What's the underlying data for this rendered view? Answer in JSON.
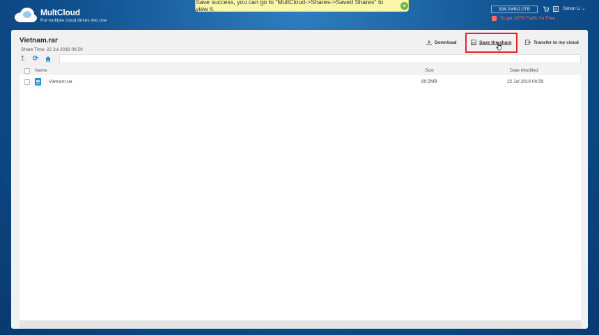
{
  "header": {
    "logo_title": "MultCloud",
    "logo_subtitle": "Put multiple cloud drives into one",
    "toast_message": "Save success, you can go to \"MultCloud->Shares->Saved Shares\" to view it.",
    "quota": "334.2MB/2.0TB",
    "user_name": "Simon Li",
    "promo": "To get 10TB Traffic for Free"
  },
  "share": {
    "title": "Vietnam.rar",
    "time_label": "Share Time:",
    "time_value": "22 Jul 2016 06:59"
  },
  "actions": {
    "download": "Download",
    "save": "Save the share",
    "transfer": "Transfer to my cloud"
  },
  "columns": {
    "name": "Name",
    "size": "Size",
    "date": "Date Modified"
  },
  "files": [
    {
      "name": "Vietnam.rar",
      "size": "89.5MB",
      "date": "22 Jul 2016 06:59"
    }
  ],
  "icons": {
    "logo": "cloud-icon",
    "toast_close": "close-icon",
    "cart": "cart-icon",
    "settings": "settings-icon",
    "gift": "gift-icon",
    "download": "download-icon",
    "save": "save-icon",
    "transfer": "transfer-icon",
    "up": "up-arrow-icon",
    "refresh": "refresh-icon",
    "home": "home-icon",
    "file": "archive-file-icon"
  },
  "colors": {
    "brand_blue": "#1c86d1",
    "highlight_red": "#e0242b",
    "toast_bg": "#fbf7a8",
    "promo_red": "#ff6b5c"
  }
}
